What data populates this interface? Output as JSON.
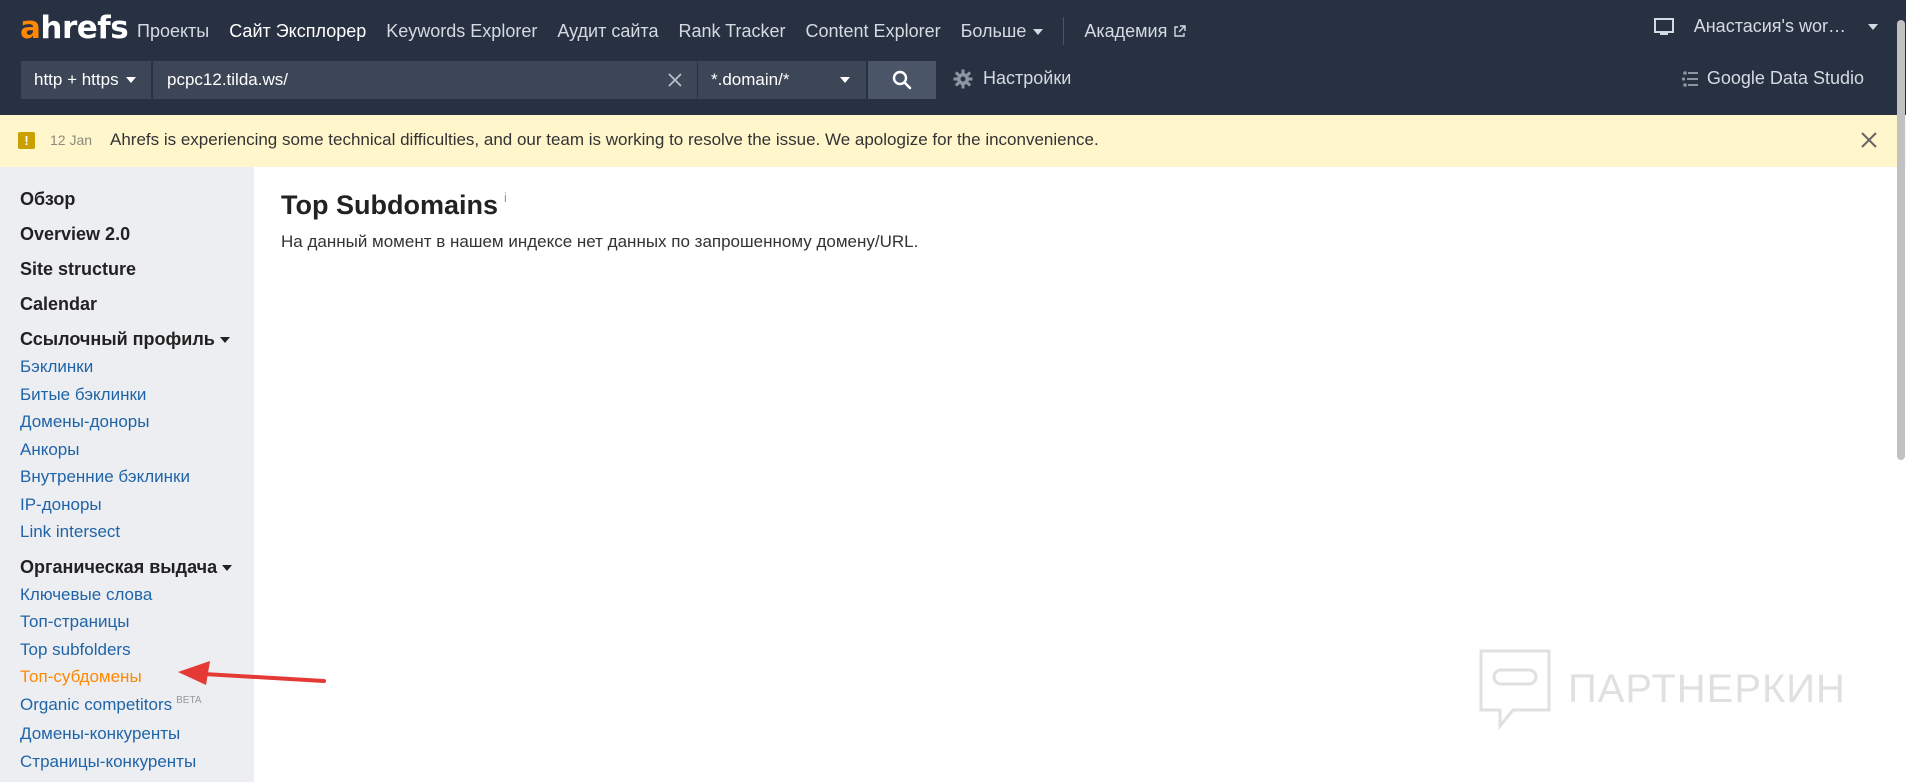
{
  "logo": {
    "a": "a",
    "rest": "hrefs"
  },
  "nav": {
    "items": [
      "Проекты",
      "Сайт Эксплорер",
      "Keywords Explorer",
      "Аудит сайта",
      "Rank Tracker",
      "Content Explorer"
    ],
    "more_label": "Больше",
    "academy_label": "Академия",
    "user_label": "Анастасия's wor…"
  },
  "search": {
    "protocol": "http + https",
    "url_value": "pcpc12.tilda.ws/",
    "mode": "*.domain/*",
    "settings_label": "Настройки",
    "gds_label": "Google Data Studio"
  },
  "alert": {
    "date": "12 Jan",
    "message": "Ahrefs is experiencing some technical difficulties, and our team is working to resolve the issue. We apologize for the inconvenience."
  },
  "sidebar": {
    "overview": "Обзор",
    "overview2": "Overview 2.0",
    "site_structure": "Site structure",
    "calendar": "Calendar",
    "backlink_profile": "Ссылочный профиль",
    "backlink_links": [
      "Бэклинки",
      "Битые бэклинки",
      "Домены-доноры",
      "Анкоры",
      "Внутренние бэклинки",
      "IP-доноры",
      "Link intersect"
    ],
    "organic": "Органическая выдача",
    "organic_links": [
      "Ключевые слова",
      "Топ-страницы",
      "Top subfolders",
      "Топ-субдомены"
    ],
    "organic_competitors": "Organic competitors",
    "beta": "BETA",
    "more_links": [
      "Домены-конкуренты",
      "Страницы-конкуренты"
    ]
  },
  "main": {
    "title": "Top Subdomains",
    "info": "i",
    "message": "На данный момент в нашем индексе нет данных по запрошенному домену/URL."
  },
  "watermark": "ПАРТНЕРКИН",
  "colors": {
    "nav_bg": "#283141",
    "accent_orange": "#ff8800",
    "link_blue": "#1f64a8",
    "alert_bg": "#fff6cc",
    "arrow_red": "#e53935"
  }
}
